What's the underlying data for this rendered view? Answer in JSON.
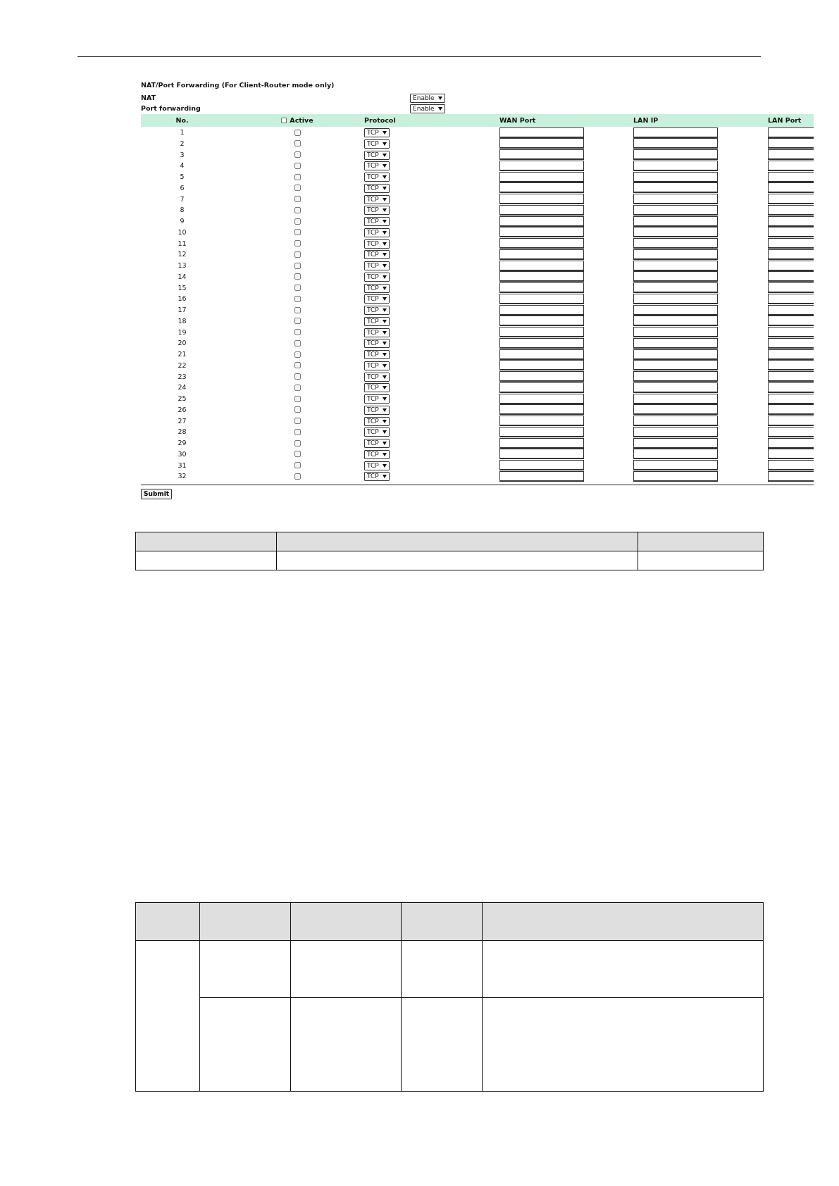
{
  "nat_form": {
    "title": "NAT/Port Forwarding (For Client-Router mode only)",
    "settings": [
      {
        "label": "NAT",
        "value": "Enable"
      },
      {
        "label": "Port forwarding",
        "value": "Enable"
      }
    ],
    "columns": {
      "no": "No.",
      "active": "Active",
      "active_all_checked": false,
      "protocol": "Protocol",
      "wan_port": "WAN Port",
      "lan_ip": "LAN IP",
      "lan_port": "LAN Port"
    },
    "rows": [
      {
        "no": "1",
        "active": false,
        "protocol": "TCP"
      },
      {
        "no": "2",
        "active": false,
        "protocol": "TCP"
      },
      {
        "no": "3",
        "active": false,
        "protocol": "TCP"
      },
      {
        "no": "4",
        "active": false,
        "protocol": "TCP"
      },
      {
        "no": "5",
        "active": false,
        "protocol": "TCP"
      },
      {
        "no": "6",
        "active": false,
        "protocol": "TCP"
      },
      {
        "no": "7",
        "active": false,
        "protocol": "TCP"
      },
      {
        "no": "8",
        "active": false,
        "protocol": "TCP"
      },
      {
        "no": "9",
        "active": false,
        "protocol": "TCP"
      },
      {
        "no": "10",
        "active": false,
        "protocol": "TCP"
      },
      {
        "no": "11",
        "active": false,
        "protocol": "TCP"
      },
      {
        "no": "12",
        "active": false,
        "protocol": "TCP"
      },
      {
        "no": "13",
        "active": false,
        "protocol": "TCP"
      },
      {
        "no": "14",
        "active": false,
        "protocol": "TCP"
      },
      {
        "no": "15",
        "active": false,
        "protocol": "TCP"
      },
      {
        "no": "16",
        "active": false,
        "protocol": "TCP"
      },
      {
        "no": "17",
        "active": false,
        "protocol": "TCP"
      },
      {
        "no": "18",
        "active": false,
        "protocol": "TCP"
      },
      {
        "no": "19",
        "active": false,
        "protocol": "TCP"
      },
      {
        "no": "20",
        "active": false,
        "protocol": "TCP"
      },
      {
        "no": "21",
        "active": false,
        "protocol": "TCP"
      },
      {
        "no": "22",
        "active": false,
        "protocol": "TCP"
      },
      {
        "no": "23",
        "active": false,
        "protocol": "TCP"
      },
      {
        "no": "24",
        "active": false,
        "protocol": "TCP"
      },
      {
        "no": "25",
        "active": false,
        "protocol": "TCP"
      },
      {
        "no": "26",
        "active": false,
        "protocol": "TCP"
      },
      {
        "no": "27",
        "active": false,
        "protocol": "TCP"
      },
      {
        "no": "28",
        "active": false,
        "protocol": "TCP"
      },
      {
        "no": "29",
        "active": false,
        "protocol": "TCP"
      },
      {
        "no": "30",
        "active": false,
        "protocol": "TCP"
      },
      {
        "no": "31",
        "active": false,
        "protocol": "TCP"
      },
      {
        "no": "32",
        "active": false,
        "protocol": "TCP"
      }
    ],
    "submit": "Submit"
  }
}
